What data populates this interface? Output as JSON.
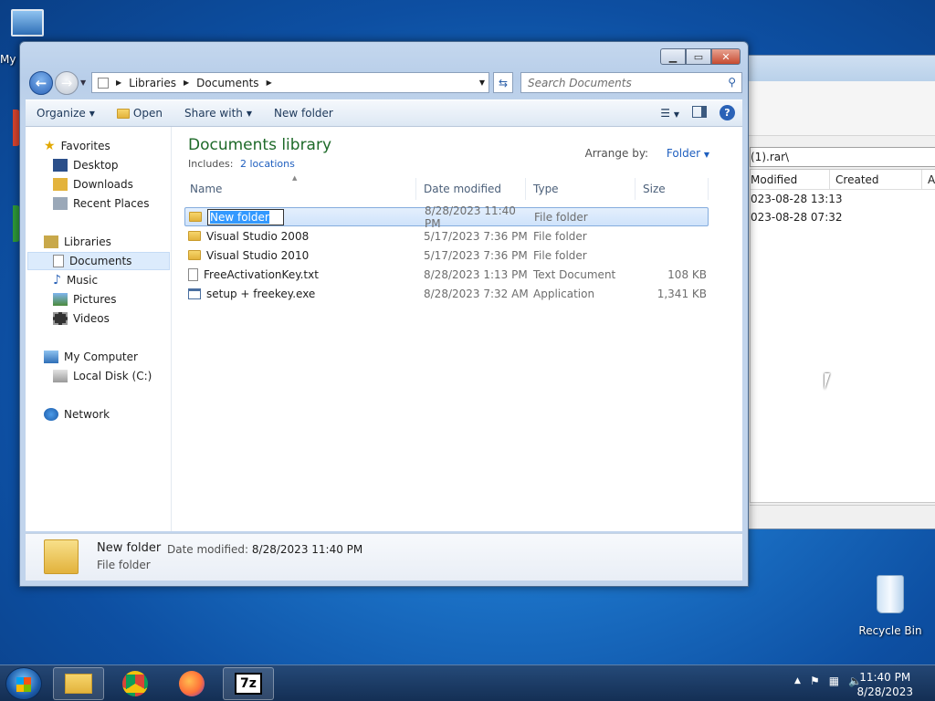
{
  "desktop": {
    "my_computer_label": "My",
    "recycle_bin_label": "Recycle Bin"
  },
  "background_window": {
    "path": "(1).rar\\",
    "columns": [
      "Modified",
      "Created",
      "A"
    ],
    "rows": [
      "023-08-28 13:13",
      "023-08-28 07:32"
    ]
  },
  "explorer": {
    "breadcrumb": [
      "Libraries",
      "Documents"
    ],
    "search_placeholder": "Search Documents",
    "toolbar": {
      "organize": "Organize",
      "open": "Open",
      "share_with": "Share with",
      "new_folder": "New folder"
    },
    "nav_pane": {
      "favorites": "Favorites",
      "desktop": "Desktop",
      "downloads": "Downloads",
      "recent_places": "Recent Places",
      "libraries": "Libraries",
      "documents": "Documents",
      "music": "Music",
      "pictures": "Pictures",
      "videos": "Videos",
      "my_computer": "My Computer",
      "local_disk": "Local Disk (C:)",
      "network": "Network"
    },
    "library": {
      "title": "Documents library",
      "includes_label": "Includes:",
      "locations_link": "2 locations",
      "arrange_label": "Arrange by:",
      "arrange_value": "Folder"
    },
    "columns": {
      "name": "Name",
      "date_modified": "Date modified",
      "type": "Type",
      "size": "Size"
    },
    "files": [
      {
        "name": "New folder",
        "date": "8/28/2023 11:40 PM",
        "type": "File folder",
        "size": ""
      },
      {
        "name": "Visual Studio 2008",
        "date": "5/17/2023 7:36 PM",
        "type": "File folder",
        "size": ""
      },
      {
        "name": "Visual Studio 2010",
        "date": "5/17/2023 7:36 PM",
        "type": "File folder",
        "size": ""
      },
      {
        "name": "FreeActivationKey.txt",
        "date": "8/28/2023 1:13 PM",
        "type": "Text Document",
        "size": "108 KB"
      },
      {
        "name": "setup + freekey.exe",
        "date": "8/28/2023 7:32 AM",
        "type": "Application",
        "size": "1,341 KB"
      }
    ],
    "details": {
      "name": "New folder",
      "modified_label": "Date modified:",
      "modified_value": "8/28/2023 11:40 PM",
      "type": "File folder"
    }
  },
  "taskbar": {
    "time": "11:40 PM",
    "date": "8/28/2023",
    "sevenzip_label": "7z"
  }
}
